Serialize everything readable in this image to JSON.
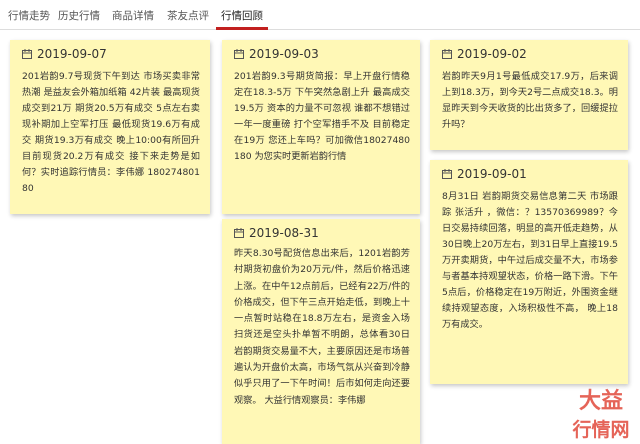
{
  "tabs": [
    {
      "label": "行情走势"
    },
    {
      "label": "历史行情"
    },
    {
      "label": "商品详情"
    },
    {
      "label": "茶友点评"
    },
    {
      "label": "行情回顾"
    }
  ],
  "active_tab": "行情回顾",
  "cards": [
    {
      "date": "2019-09-07",
      "text": "201岩韵9.7号现货下午到达 市场买卖非常热潮 是益友会外箱加纸箱 42片装 最高现货成交到21万 期货20.5万有成交 5点左右卖现补期加上空军打压 最低现货19.6万有成交 期货19.3万有成交 晚上10:00有所回升 目前现货20.2万有成交 接下来走势是如何？实时追踪行情员：李伟娜 18027480180"
    },
    {
      "date": "2019-09-03",
      "text": "201岩韵9.3号期货简报：早上开盘行情稳定在18.3-5万 下午突然急剧上升 最高成交19.5万 资本的力量不可忽视 谁都不想错过一年一度重磅 打个空军措手不及 目前稳定在19万 您还上车吗？可加微信18027480180 为您实时更新岩韵行情"
    },
    {
      "date": "2019-09-02",
      "text": "岩韵昨天9月1号最低成交17.9万，后来调上到18.3万，到今天2号二点成交18.3。明显昨天到今天收货的比出货多了，回缓提拉升吗？"
    },
    {
      "date": "2019-08-31",
      "text": "昨天8.30号配货信息出来后，1201岩韵芳村期货初盘价为20万元/件，然后价格迅速上涨。在中午12点前后，已经有22万/件的价格成交，但下午三点开始走低，到晚上十一点暂时站稳在18.8万左右，是资金入场扫货还是空头扑单暂不明朗，总体看30日岩韵期货交易量不大，主要原因还是市场普遍认为开盘价太高，市场气氛从兴奋到冷静似乎只用了一下午时间！后市如何走向还要观察。  大益行情观察员：李伟娜"
    },
    {
      "date": "2019-09-01",
      "text": "8月31日 岩韵期货交易信息第二天 市场跟踪 张活升 ，微信：？13570369989？今日交易持续回落，明显的高开低走趋势，从30日晚上20万左右，到31日早上直接19.5万开卖期货，中午过后成交量不大，市场参与者基本持观望状态，价格一路下滑。下午5点后，价格稳定在19万附近，外围资金继续持观望态度，入场积极性不高， 晚上18万有成交。"
    }
  ],
  "watermark": {
    "top": "大益",
    "bottom": "行情网"
  },
  "colors": {
    "accent": "#c2201f",
    "note": "#fff8b6",
    "watermark": "#e14a3c"
  }
}
